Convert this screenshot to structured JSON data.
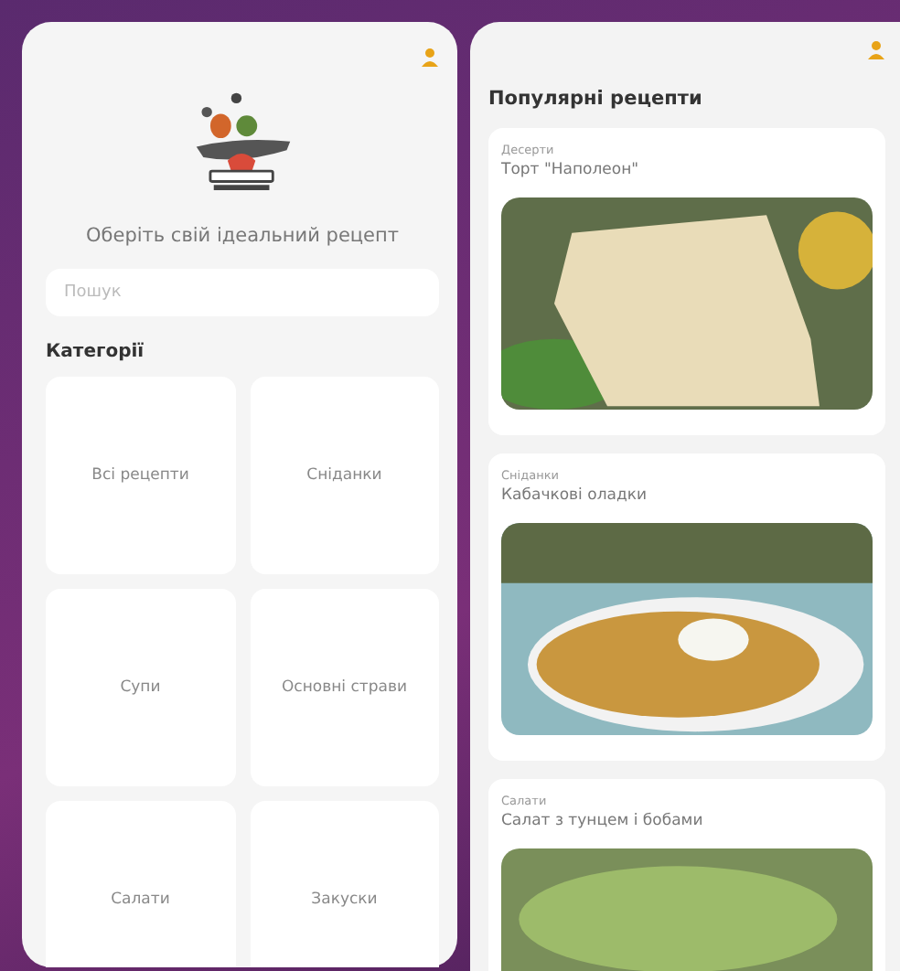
{
  "home": {
    "tagline": "Оберіть свій ідеальний рецепт",
    "search": {
      "placeholder": "Пошук"
    },
    "categories_title": "Категорії",
    "categories": [
      {
        "label": "Всі рецепти"
      },
      {
        "label": "Сніданки"
      },
      {
        "label": "Супи"
      },
      {
        "label": "Основні страви"
      },
      {
        "label": "Салати"
      },
      {
        "label": "Закуски"
      }
    ]
  },
  "popular": {
    "title": "Популярні рецепти",
    "recipes": [
      {
        "category": "Десерти",
        "name": "Торт \"Наполеон\"",
        "kind": "cake"
      },
      {
        "category": "Сніданки",
        "name": "Кабачкові оладки",
        "kind": "fritters"
      },
      {
        "category": "Салати",
        "name": "Салат з тунцем і бобами",
        "kind": "salad"
      }
    ]
  }
}
